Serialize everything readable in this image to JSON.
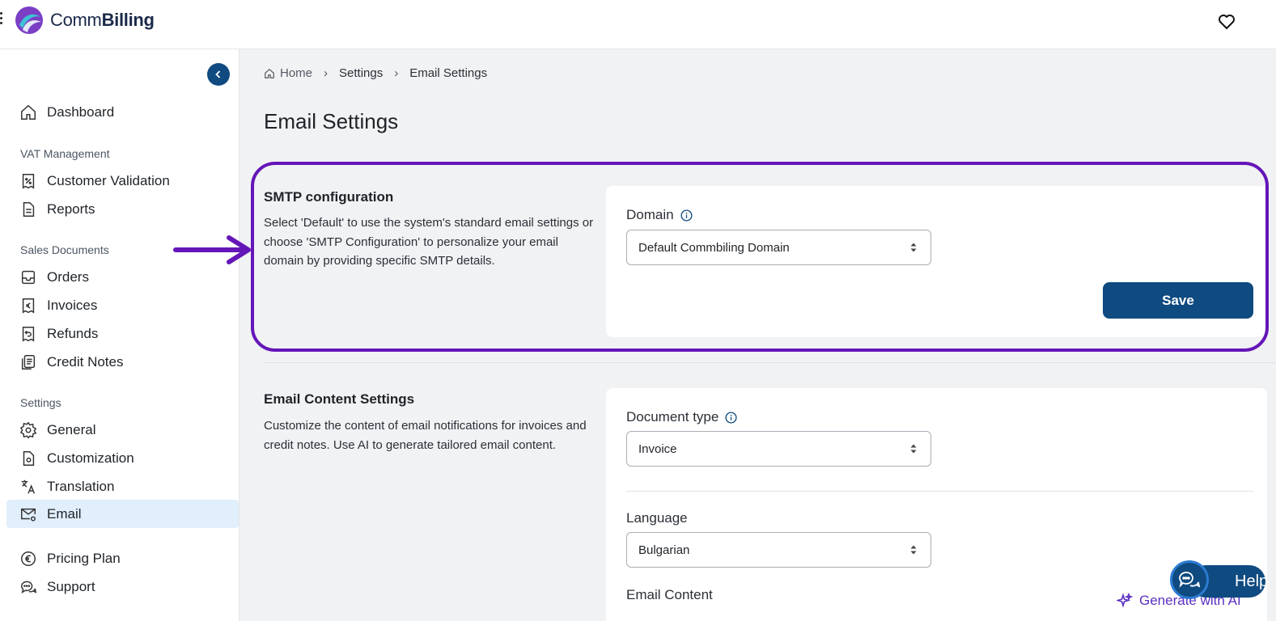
{
  "app": {
    "logo_regular": "Comm",
    "logo_bold": "Billing"
  },
  "sidebar": {
    "dashboard": "Dashboard",
    "vat_section": "VAT Management",
    "customer_validation": "Customer Validation",
    "reports": "Reports",
    "sales_section": "Sales Documents",
    "orders": "Orders",
    "invoices": "Invoices",
    "refunds": "Refunds",
    "credit_notes": "Credit Notes",
    "settings_section": "Settings",
    "general": "General",
    "customization": "Customization",
    "translation": "Translation",
    "email": "Email",
    "pricing_plan": "Pricing Plan",
    "support": "Support"
  },
  "breadcrumb": {
    "home": "Home",
    "settings": "Settings",
    "current": "Email Settings"
  },
  "page": {
    "title": "Email Settings"
  },
  "smtp": {
    "title": "SMTP configuration",
    "description": "Select 'Default' to use the system's standard email settings or choose 'SMTP Configuration' to personalize your email domain by providing specific SMTP details.",
    "domain_label": "Domain",
    "domain_value": "Default Commbiling Domain",
    "save_label": "Save"
  },
  "content": {
    "title": "Email Content Settings",
    "description": "Customize the content of email notifications for invoices and credit notes. Use AI to generate tailored email content.",
    "doc_type_label": "Document type",
    "doc_type_value": "Invoice",
    "language_label": "Language",
    "language_value": "Bulgarian",
    "email_content_label": "Email Content",
    "generate_ai_label": "Generate with AI"
  },
  "help": {
    "label": "Help"
  },
  "colors": {
    "primary": "#0f4a80",
    "highlight": "#6416b8",
    "active_bg": "#e1effc"
  }
}
